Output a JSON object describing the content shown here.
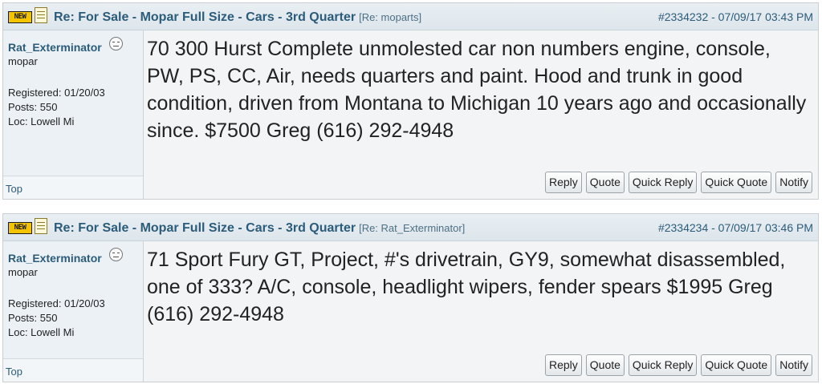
{
  "posts": [
    {
      "new_badge": "NEW",
      "subject": "Re: For Sale - Mopar Full Size - Cars - 3rd Quarter",
      "re_tag": "[Re: moparts]",
      "meta": "#2334232 - 07/09/17 03:43 PM",
      "author": "Rat_Exterminator",
      "user_title": "mopar",
      "registered": "Registered: 01/20/03",
      "posts_count": "Posts: 550",
      "location": "Loc: Lowell Mi",
      "top_link": "Top",
      "body": "70 300 Hurst Complete unmolested car non numbers engine, console, PW, PS, CC, Air, needs quarters and paint. Hood and trunk in good condition, driven from Montana to Michigan 10 years ago and occasionally since. $7500 Greg (616) 292-4948",
      "buttons": [
        "Reply",
        "Quote",
        "Quick Reply",
        "Quick Quote",
        "Notify"
      ]
    },
    {
      "new_badge": "NEW",
      "subject": "Re: For Sale - Mopar Full Size - Cars - 3rd Quarter",
      "re_tag": "[Re: Rat_Exterminator]",
      "meta": "#2334234 - 07/09/17 03:46 PM",
      "author": "Rat_Exterminator",
      "user_title": "mopar",
      "registered": "Registered: 01/20/03",
      "posts_count": "Posts: 550",
      "location": "Loc: Lowell Mi",
      "top_link": "Top",
      "body": "71 Sport Fury GT, Project, #'s drivetrain, GY9, somewhat disassembled, one of 333? A/C, console, headlight wipers, fender spears $1995 Greg (616) 292-4948",
      "buttons": [
        "Reply",
        "Quote",
        "Quick Reply",
        "Quick Quote",
        "Notify"
      ]
    }
  ]
}
